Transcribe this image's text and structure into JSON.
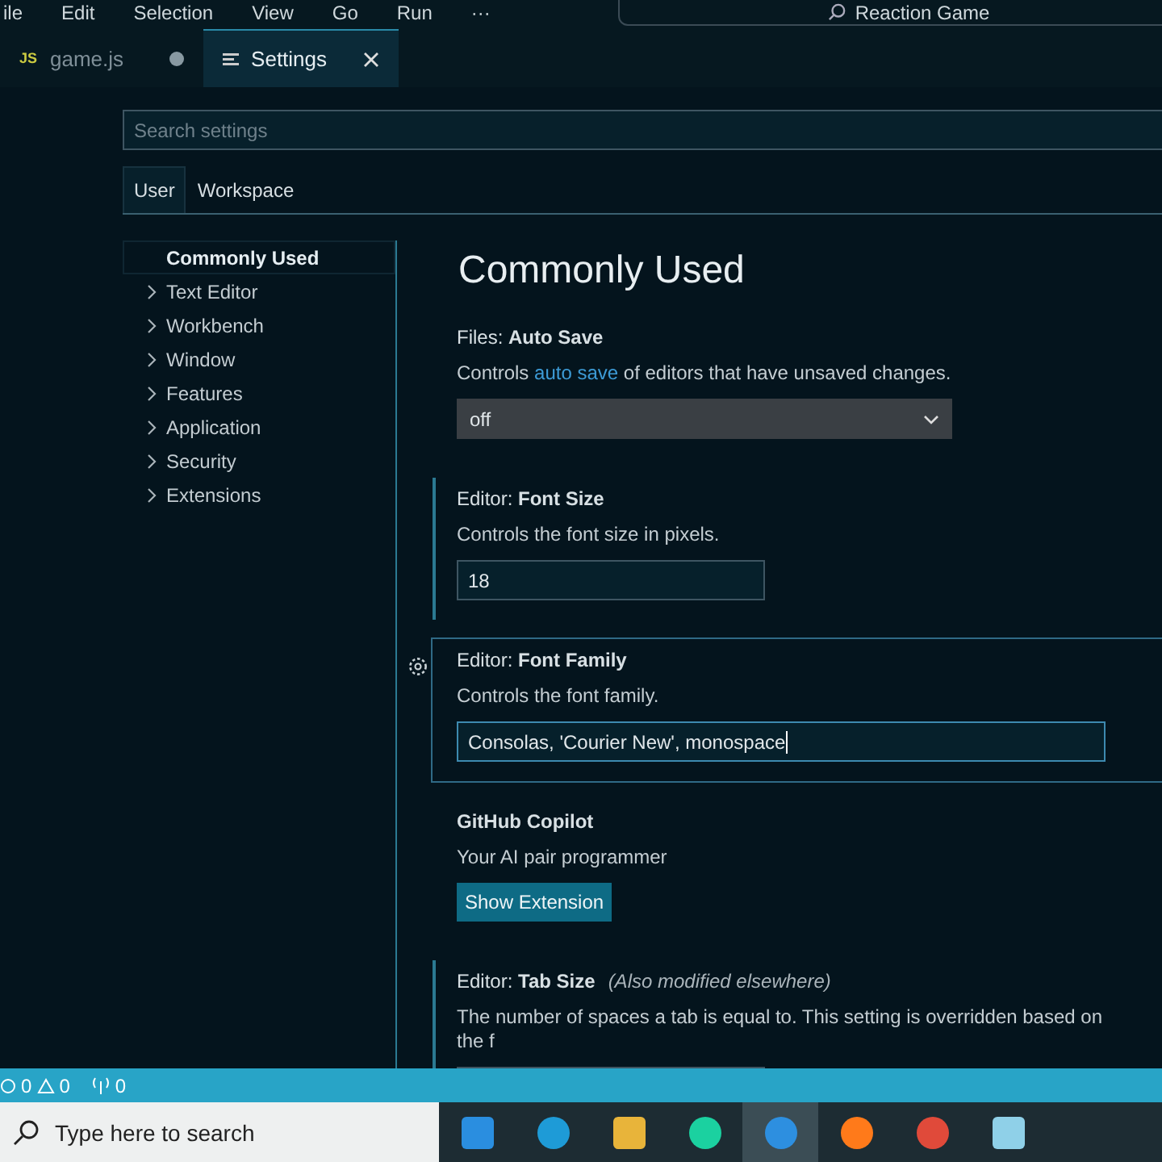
{
  "menu_bar": {
    "items": [
      "ile",
      "Edit",
      "Selection",
      "View",
      "Go",
      "Run",
      "···"
    ],
    "command_center": "Reaction Game"
  },
  "editor_tabs": [
    {
      "label": "game.js",
      "icon": "JS",
      "kind": "js",
      "selected": false,
      "dirty": true
    },
    {
      "label": "Settings",
      "kind": "settings",
      "selected": true,
      "dirty": false
    }
  ],
  "search": {
    "placeholder": "Search settings"
  },
  "scope_tabs": [
    {
      "label": "User",
      "selected": true
    },
    {
      "label": "Workspace",
      "selected": false
    }
  ],
  "toc": [
    {
      "label": "Commonly Used",
      "selected": true,
      "has_children": false
    },
    {
      "label": "Text Editor",
      "selected": false,
      "has_children": true
    },
    {
      "label": "Workbench",
      "selected": false,
      "has_children": true
    },
    {
      "label": "Window",
      "selected": false,
      "has_children": true
    },
    {
      "label": "Features",
      "selected": false,
      "has_children": true
    },
    {
      "label": "Application",
      "selected": false,
      "has_children": true
    },
    {
      "label": "Security",
      "selected": false,
      "has_children": true
    },
    {
      "label": "Extensions",
      "selected": false,
      "has_children": true
    }
  ],
  "section_title": "Commonly Used",
  "settings": [
    {
      "kind": "dropdown",
      "category": "Files: ",
      "name": "Auto Save",
      "description": "Controls **auto save** of editors that have unsaved changes.",
      "value": "off",
      "modified": false,
      "focused": false
    },
    {
      "kind": "text",
      "category": "Editor: ",
      "name": "Font Size",
      "description": "Controls the font size in pixels.",
      "value": "18",
      "modified": true,
      "focused": false
    },
    {
      "kind": "text",
      "category": "Editor: ",
      "name": "Font Family",
      "description": "Controls the font family.",
      "value": "Consolas, 'Courier New', monospace",
      "modified": false,
      "focused": true
    },
    {
      "kind": "button",
      "name": "GitHub Copilot",
      "description": "Your AI pair programmer",
      "button": "Show Extension",
      "modified": false,
      "focused": false
    },
    {
      "kind": "number",
      "category": "Editor: ",
      "name": "Tab Size",
      "note": "(Also modified elsewhere)",
      "description": "The number of spaces a tab is equal to. This setting is overridden based on the f",
      "modified": true,
      "focused": false
    }
  ],
  "status_bar": {
    "errors": "0",
    "warnings": "0",
    "ports": "0"
  },
  "taskbar": {
    "search_placeholder": "Type here to search",
    "apps": [
      {
        "kind": "mail",
        "active": false
      },
      {
        "kind": "edge",
        "active": false
      },
      {
        "kind": "folder",
        "active": false
      },
      {
        "kind": "filmora",
        "active": false
      },
      {
        "kind": "vscode",
        "active": true
      },
      {
        "kind": "firefox",
        "active": false
      },
      {
        "kind": "chrome",
        "active": false
      },
      {
        "kind": "notepad",
        "active": false
      }
    ]
  }
}
